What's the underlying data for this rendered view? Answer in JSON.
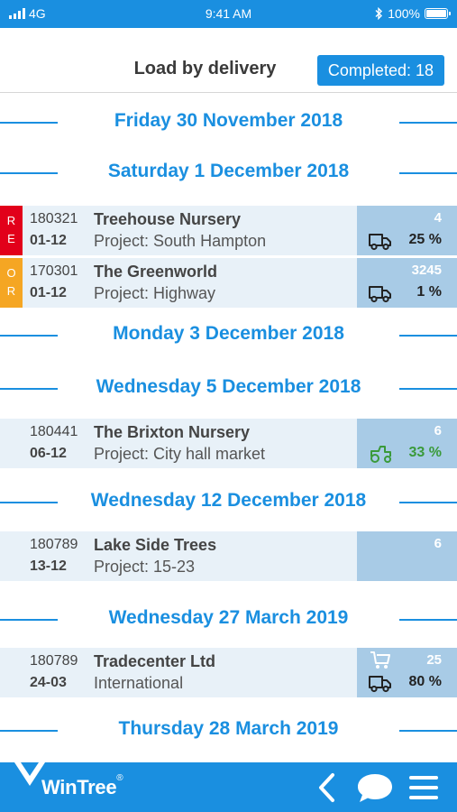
{
  "status_bar": {
    "carrier": "4G",
    "time": "9:41 AM",
    "battery": "100%"
  },
  "header": {
    "title": "Load by delivery",
    "completed_label": "Completed: 18"
  },
  "date_headers": [
    "Friday 30 November 2018",
    "Saturday 1 December 2018",
    "Monday 3 December 2018",
    "Wednesday 5 December 2018",
    "Wednesday 12 December 2018",
    "Wednesday 27 March 2019",
    "Thursday 28 March 2019"
  ],
  "orders": [
    {
      "tag_letters": [
        "R",
        "E"
      ],
      "tag_color": "#e2001a",
      "number": "180321",
      "date": "01-12",
      "name": "Treehouse Nursery",
      "project": "Project: South Hampton",
      "quantity": "4",
      "percent": "25 %",
      "vehicle_icon": "truck-icon",
      "extra_icon": ""
    },
    {
      "tag_letters": [
        "O",
        "R"
      ],
      "tag_color": "#f5a623",
      "number": "170301",
      "date": "01-12",
      "name": "The Greenworld",
      "project": "Project: Highway",
      "quantity": "3245",
      "percent": "1 %",
      "vehicle_icon": "truck-icon",
      "extra_icon": ""
    },
    {
      "tag_letters": [],
      "tag_color": "",
      "number": "180441",
      "date": "06-12",
      "name": "The Brixton Nursery",
      "project": "Project: City hall market",
      "quantity": "6",
      "percent": "33 %",
      "vehicle_icon": "tractor-icon",
      "extra_icon": ""
    },
    {
      "tag_letters": [],
      "tag_color": "",
      "number": "180789",
      "date": "13-12",
      "name": "Lake Side Trees",
      "project": "Project: 15-23",
      "quantity": "6",
      "percent": "",
      "vehicle_icon": "",
      "extra_icon": ""
    },
    {
      "tag_letters": [],
      "tag_color": "",
      "number": "180789",
      "date": "24-03",
      "name": "Tradecenter Ltd",
      "project": "International",
      "quantity": "25",
      "percent": "80 %",
      "vehicle_icon": "truck-icon",
      "extra_icon": "cart-icon"
    }
  ],
  "footer": {
    "brand": "WinTree",
    "brand_mark": "®"
  },
  "colors": {
    "accent": "#1a8fe0",
    "row_bg": "#e8f1f8",
    "status_bg": "#a8cbe6",
    "tag_red": "#e2001a",
    "tag_orange": "#f5a623",
    "green": "#3a9a3a"
  }
}
